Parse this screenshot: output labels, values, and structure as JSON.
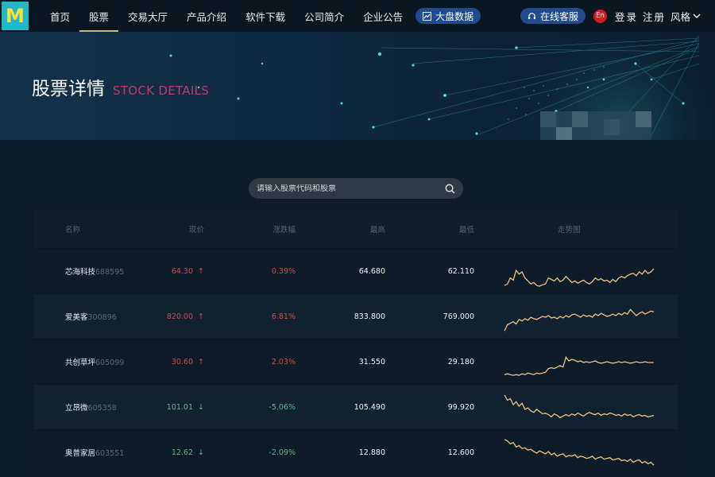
{
  "nav": {
    "logo": "M",
    "items": [
      "首页",
      "股票",
      "交易大厅",
      "产品介绍",
      "软件下载",
      "公司简介",
      "企业公告"
    ],
    "active_index": 1,
    "big_data_label": "大盘数据",
    "service_label": "在线客服",
    "lang_label": "En",
    "auth_label": "登录 注册",
    "style_label": "风格"
  },
  "banner": {
    "title_cn": "股票详情",
    "title_en": "STOCK DETAILS"
  },
  "search": {
    "placeholder": "请输入股票代码和股票"
  },
  "table": {
    "headers": {
      "name": "名称",
      "price": "现价",
      "change": "涨跌幅",
      "high": "最高",
      "low": "最低",
      "trend": "走势图"
    },
    "rows": [
      {
        "name": "芯海科技",
        "code": "688595",
        "price": "64.30",
        "direction": "up",
        "arrow": "↑",
        "change": "0.39%",
        "high": "64.680",
        "low": "62.110",
        "trend": [
          40,
          38,
          30,
          33,
          20,
          25,
          22,
          30,
          34,
          38,
          36,
          40,
          41,
          39,
          38,
          30,
          32,
          34,
          30,
          35,
          33,
          28,
          32,
          36,
          34,
          37,
          35,
          33,
          36,
          38,
          35,
          30,
          33,
          31,
          34,
          33,
          36,
          32,
          35,
          30,
          28,
          30,
          27,
          25,
          24,
          27,
          22,
          25,
          20,
          24,
          22,
          18
        ]
      },
      {
        "name": "爱美客",
        "code": "300896",
        "price": "820.00",
        "direction": "up",
        "arrow": "↑",
        "change": "6.81%",
        "high": "833.800",
        "low": "769.000",
        "trend": [
          40,
          32,
          30,
          28,
          31,
          25,
          27,
          24,
          26,
          22,
          24,
          25,
          23,
          21,
          22,
          20,
          23,
          22,
          24,
          21,
          23,
          20,
          22,
          19,
          18,
          20,
          22,
          19,
          21,
          20,
          22,
          18,
          20,
          17,
          19,
          21,
          20,
          18,
          20,
          17,
          19,
          16,
          18,
          12,
          16,
          20,
          17,
          15,
          18,
          16,
          14,
          15
        ]
      },
      {
        "name": "共创草坪",
        "code": "605099",
        "price": "30.60",
        "direction": "up",
        "arrow": "↑",
        "change": "2.03%",
        "high": "31.550",
        "low": "29.180",
        "trend": [
          38,
          37,
          38,
          39,
          38,
          39,
          37,
          38,
          36,
          37,
          38,
          36,
          37,
          36,
          35,
          30,
          29,
          30,
          28,
          26,
          28,
          15,
          20,
          18,
          19,
          21,
          20,
          22,
          21,
          22,
          21,
          20,
          22,
          23,
          22,
          21,
          22,
          23,
          22,
          21,
          22,
          21,
          22,
          23,
          22,
          21,
          22,
          22,
          21,
          22,
          22,
          22
        ]
      },
      {
        "name": "立昂微",
        "code": "605358",
        "price": "101.01",
        "direction": "down",
        "arrow": "↓",
        "change": "-5.06%",
        "high": "105.490",
        "low": "99.920",
        "trend": [
          5,
          12,
          10,
          18,
          14,
          20,
          16,
          24,
          22,
          26,
          28,
          24,
          27,
          30,
          29,
          31,
          34,
          30,
          32,
          35,
          33,
          31,
          33,
          30,
          32,
          29,
          31,
          33,
          30,
          28,
          30,
          31,
          29,
          32,
          30,
          31,
          29,
          30,
          32,
          31,
          33,
          30,
          32,
          31,
          34,
          32,
          31,
          33,
          32,
          34,
          33,
          32
        ]
      },
      {
        "name": "奥普家居",
        "code": "603551",
        "price": "12.62",
        "direction": "down",
        "arrow": "↓",
        "change": "-2.09%",
        "high": "12.880",
        "low": "12.600",
        "trend": [
          4,
          6,
          10,
          8,
          14,
          12,
          16,
          15,
          18,
          17,
          20,
          22,
          19,
          21,
          23,
          20,
          24,
          22,
          26,
          24,
          23,
          27,
          25,
          26,
          24,
          28,
          26,
          27,
          29,
          28,
          26,
          30,
          28,
          27,
          30,
          29,
          28,
          31,
          30,
          29,
          32,
          31,
          33,
          30,
          34,
          32,
          31,
          35,
          33,
          36,
          34,
          38
        ]
      }
    ]
  },
  "colors": {
    "up": "#d24b4b",
    "down": "#64b487",
    "spark": "#f3c27f",
    "accent": "#d7b76b",
    "pill": "#1e4c8f"
  }
}
